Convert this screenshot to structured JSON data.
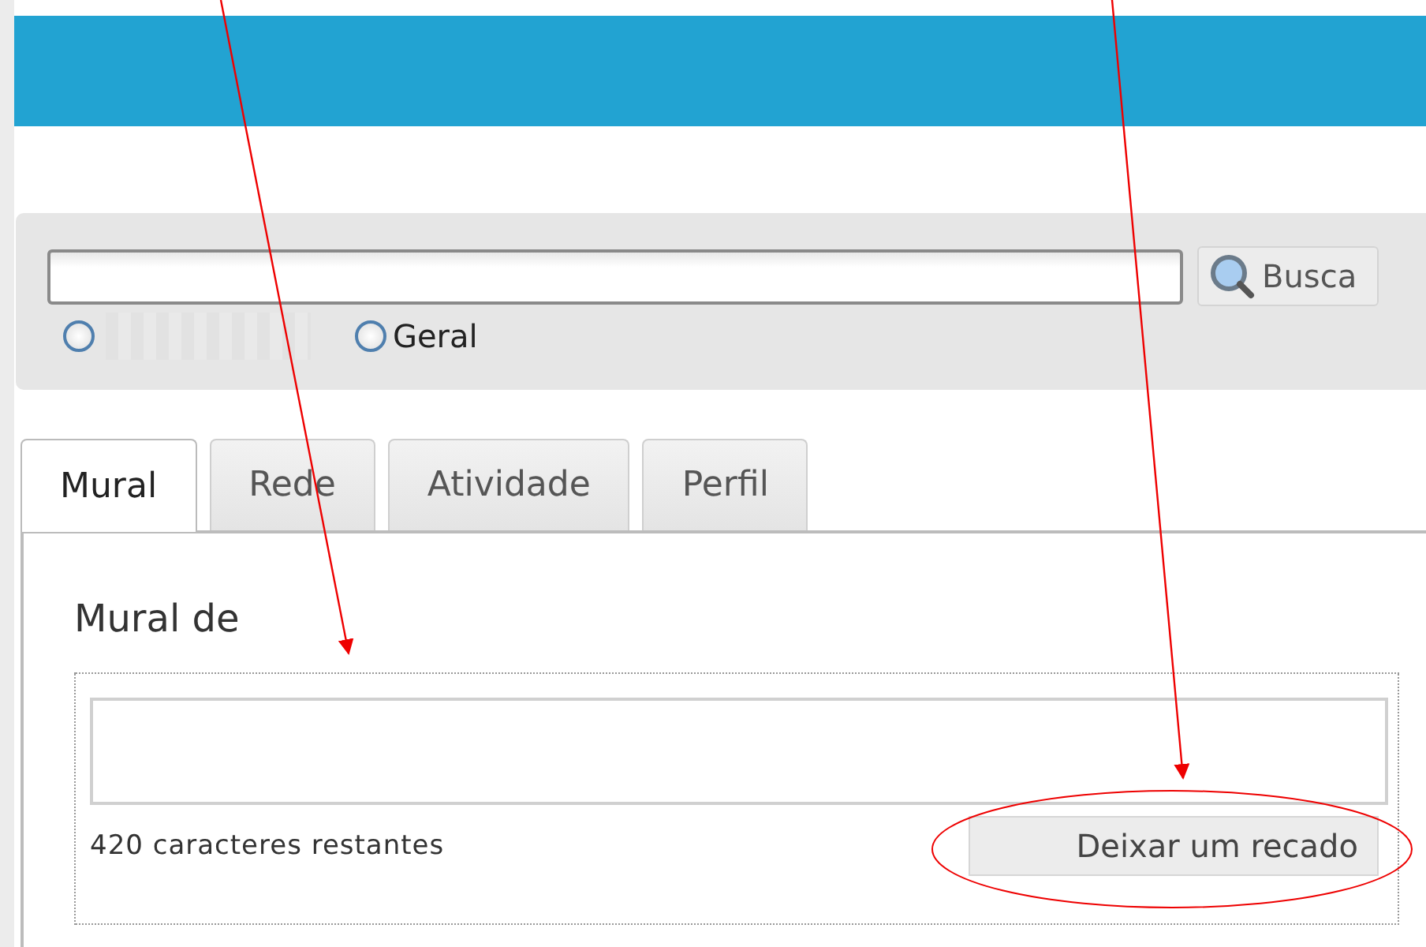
{
  "search": {
    "button": "Busca"
  },
  "scope_options": [
    {
      "selected": false
    },
    {
      "label": "Geral",
      "selected": false
    }
  ],
  "tabs": [
    {
      "label": "Mural",
      "selected": true
    },
    {
      "label": "Rede",
      "selected": false
    },
    {
      "label": "Atividade",
      "selected": false
    },
    {
      "label": "Perfil",
      "selected": false
    }
  ],
  "wall": {
    "title": "Mural de",
    "counter": "420 caracteres restantes",
    "button": "Deixar um recado"
  }
}
